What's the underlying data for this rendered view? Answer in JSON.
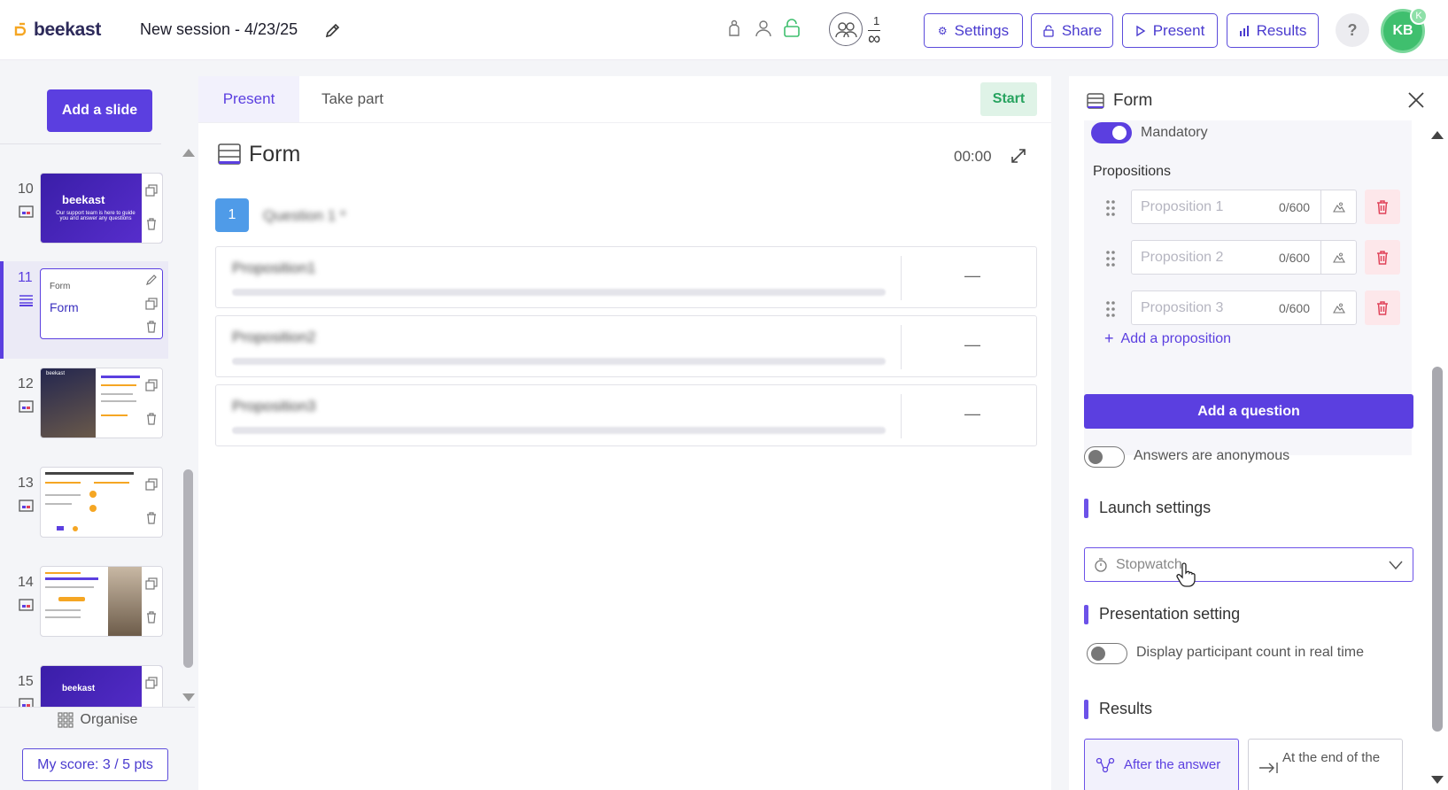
{
  "header": {
    "brand": "beekast",
    "session_title": "New session - 4/23/25",
    "participants_count": "1",
    "participants_limit": "∞",
    "buttons": {
      "settings": "Settings",
      "share": "Share",
      "present": "Present",
      "results": "Results"
    },
    "help": "?",
    "avatar_initials": "KB",
    "avatar_badge": "K"
  },
  "sidebar": {
    "add_slide": "Add a slide",
    "slides": [
      {
        "number": "10",
        "type": "image-slide",
        "thumb_brand": "beekast",
        "thumb_text": "Our support team is here to guide you and answer any questions"
      },
      {
        "number": "11",
        "type": "form",
        "thumb_small": "Form",
        "thumb_big": "Form",
        "active": true
      },
      {
        "number": "12",
        "type": "image-slide",
        "thumb_brand": "beekast"
      },
      {
        "number": "13",
        "type": "image-slide"
      },
      {
        "number": "14",
        "type": "image-slide"
      },
      {
        "number": "15",
        "type": "image-slide",
        "thumb_brand": "beekast"
      }
    ],
    "organise": "Organise",
    "score": "My score: 3 / 5 pts"
  },
  "main": {
    "tabs": {
      "present": "Present",
      "take_part": "Take part"
    },
    "start": "Start",
    "form_title": "Form",
    "timer": "00:00",
    "question_number": "1",
    "question_text": "Question 1 *",
    "propositions": [
      {
        "text": "Proposition1",
        "value": "—"
      },
      {
        "text": "Proposition2",
        "value": "—"
      },
      {
        "text": "Proposition3",
        "value": "—"
      }
    ]
  },
  "panel": {
    "title": "Form",
    "mandatory_label": "Mandatory",
    "mandatory_on": true,
    "propositions_label": "Propositions",
    "propositions": [
      {
        "placeholder": "Proposition 1",
        "count": "0/600"
      },
      {
        "placeholder": "Proposition 2",
        "count": "0/600"
      },
      {
        "placeholder": "Proposition 3",
        "count": "0/600"
      }
    ],
    "add_proposition": "Add a proposition",
    "add_question": "Add a question",
    "anonymous_label": "Answers are anonymous",
    "launch_settings": "Launch settings",
    "stopwatch_placeholder": "Stopwatch",
    "presentation_setting": "Presentation setting",
    "participant_count_label": "Display participant count in real time",
    "results": "Results",
    "results_options": {
      "after_answer": "After the answer",
      "end_of": "At the end of the"
    }
  },
  "colors": {
    "accent": "#5b3fe0",
    "start_green": "#27a35f",
    "danger": "#e0445a",
    "avatar": "#3fbf6e",
    "question_badge": "#4f9be8"
  }
}
